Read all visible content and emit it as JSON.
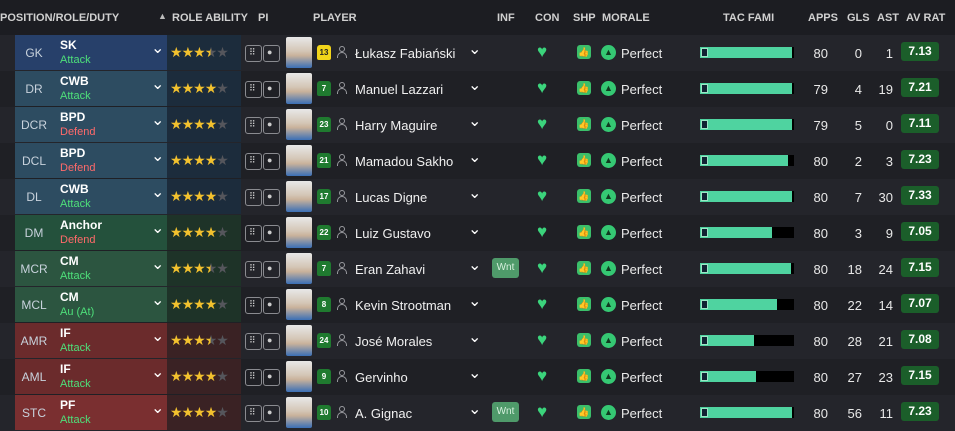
{
  "header": {
    "position": "POSITION/ROLE/DUTY",
    "role_ability": "ROLE ABILITY",
    "pi": "PI",
    "player": "PLAYER",
    "inf": "INF",
    "con": "CON",
    "shp": "SHP",
    "morale": "MORALE",
    "tac_fami": "TAC FAMI",
    "apps": "APPS",
    "gls": "GLS",
    "ast": "AST",
    "av_rat": "AV RAT"
  },
  "colors": {
    "gk": "#27406a",
    "defence": "#2d4c61",
    "dm": "#24513c",
    "midfield": "#2c5540",
    "attack": "#6b2b2c",
    "striker": "#7a2f30",
    "ability_band_def": "#1c2c3c",
    "ability_band_mid": "#1e3328",
    "ability_band_att": "#3a2224",
    "attack_duty": "#4ee07a",
    "defend_duty": "#ff6a6a",
    "star": "#f2c12e",
    "condition": "#3bd47c",
    "tac_fill": "#4fd3a0",
    "rating_bg": "#1b5e2a"
  },
  "rows": [
    {
      "pos": "GK",
      "role": "SK",
      "duty": "Attack",
      "duty_type": "attack",
      "group": "gk",
      "stars": 3.5,
      "shirt": "13",
      "gk": true,
      "name": "Łukasz Fabiański",
      "inf": "",
      "morale": "Perfect",
      "tac": 0.98,
      "apps": "80",
      "gls": "0",
      "ast": "1",
      "rating": "7.13"
    },
    {
      "pos": "DR",
      "role": "CWB",
      "duty": "Attack",
      "duty_type": "attack",
      "group": "defence",
      "stars": 4,
      "shirt": "7",
      "gk": false,
      "name": "Manuel Lazzari",
      "inf": "",
      "morale": "Perfect",
      "tac": 0.98,
      "apps": "79",
      "gls": "4",
      "ast": "19",
      "rating": "7.21"
    },
    {
      "pos": "DCR",
      "role": "BPD",
      "duty": "Defend",
      "duty_type": "defend",
      "group": "defence",
      "stars": 4,
      "shirt": "23",
      "gk": false,
      "name": "Harry Maguire",
      "inf": "",
      "morale": "Perfect",
      "tac": 0.98,
      "apps": "79",
      "gls": "5",
      "ast": "0",
      "rating": "7.11"
    },
    {
      "pos": "DCL",
      "role": "BPD",
      "duty": "Defend",
      "duty_type": "defend",
      "group": "defence",
      "stars": 4,
      "shirt": "21",
      "gk": false,
      "name": "Mamadou Sakho",
      "inf": "",
      "morale": "Perfect",
      "tac": 0.94,
      "apps": "80",
      "gls": "2",
      "ast": "3",
      "rating": "7.23"
    },
    {
      "pos": "DL",
      "role": "CWB",
      "duty": "Attack",
      "duty_type": "attack",
      "group": "defence",
      "stars": 4,
      "shirt": "17",
      "gk": false,
      "name": "Lucas Digne",
      "inf": "",
      "morale": "Perfect",
      "tac": 0.98,
      "apps": "80",
      "gls": "7",
      "ast": "30",
      "rating": "7.33"
    },
    {
      "pos": "DM",
      "role": "Anchor",
      "duty": "Defend",
      "duty_type": "defend",
      "group": "dm",
      "stars": 4,
      "shirt": "22",
      "gk": false,
      "name": "Luiz Gustavo",
      "inf": "",
      "morale": "Perfect",
      "tac": 0.77,
      "apps": "80",
      "gls": "3",
      "ast": "9",
      "rating": "7.05"
    },
    {
      "pos": "MCR",
      "role": "CM",
      "duty": "Attack",
      "duty_type": "attack",
      "group": "midfield",
      "stars": 3.5,
      "shirt": "7",
      "gk": false,
      "name": "Eran Zahavi",
      "inf": "Wnt",
      "morale": "Perfect",
      "tac": 0.97,
      "apps": "80",
      "gls": "18",
      "ast": "24",
      "rating": "7.15"
    },
    {
      "pos": "MCL",
      "role": "CM",
      "duty": "Au (At)",
      "duty_type": "attack",
      "group": "midfield",
      "stars": 4,
      "shirt": "8",
      "gk": false,
      "name": "Kevin Strootman",
      "inf": "",
      "morale": "Perfect",
      "tac": 0.82,
      "apps": "80",
      "gls": "22",
      "ast": "14",
      "rating": "7.07"
    },
    {
      "pos": "AMR",
      "role": "IF",
      "duty": "Attack",
      "duty_type": "attack",
      "group": "attack",
      "stars": 3.5,
      "shirt": "24",
      "gk": false,
      "name": "José Morales",
      "inf": "",
      "morale": "Perfect",
      "tac": 0.57,
      "apps": "80",
      "gls": "28",
      "ast": "21",
      "rating": "7.08"
    },
    {
      "pos": "AML",
      "role": "IF",
      "duty": "Attack",
      "duty_type": "attack",
      "group": "attack",
      "stars": 4,
      "shirt": "9",
      "gk": false,
      "name": "Gervinho",
      "inf": "",
      "morale": "Perfect",
      "tac": 0.6,
      "apps": "80",
      "gls": "27",
      "ast": "23",
      "rating": "7.15"
    },
    {
      "pos": "STC",
      "role": "PF",
      "duty": "Attack",
      "duty_type": "attack",
      "group": "striker",
      "stars": 4,
      "shirt": "10",
      "gk": false,
      "name": "A. Gignac",
      "inf": "Wnt",
      "morale": "Perfect",
      "tac": 0.98,
      "apps": "80",
      "gls": "56",
      "ast": "11",
      "rating": "7.23"
    }
  ]
}
